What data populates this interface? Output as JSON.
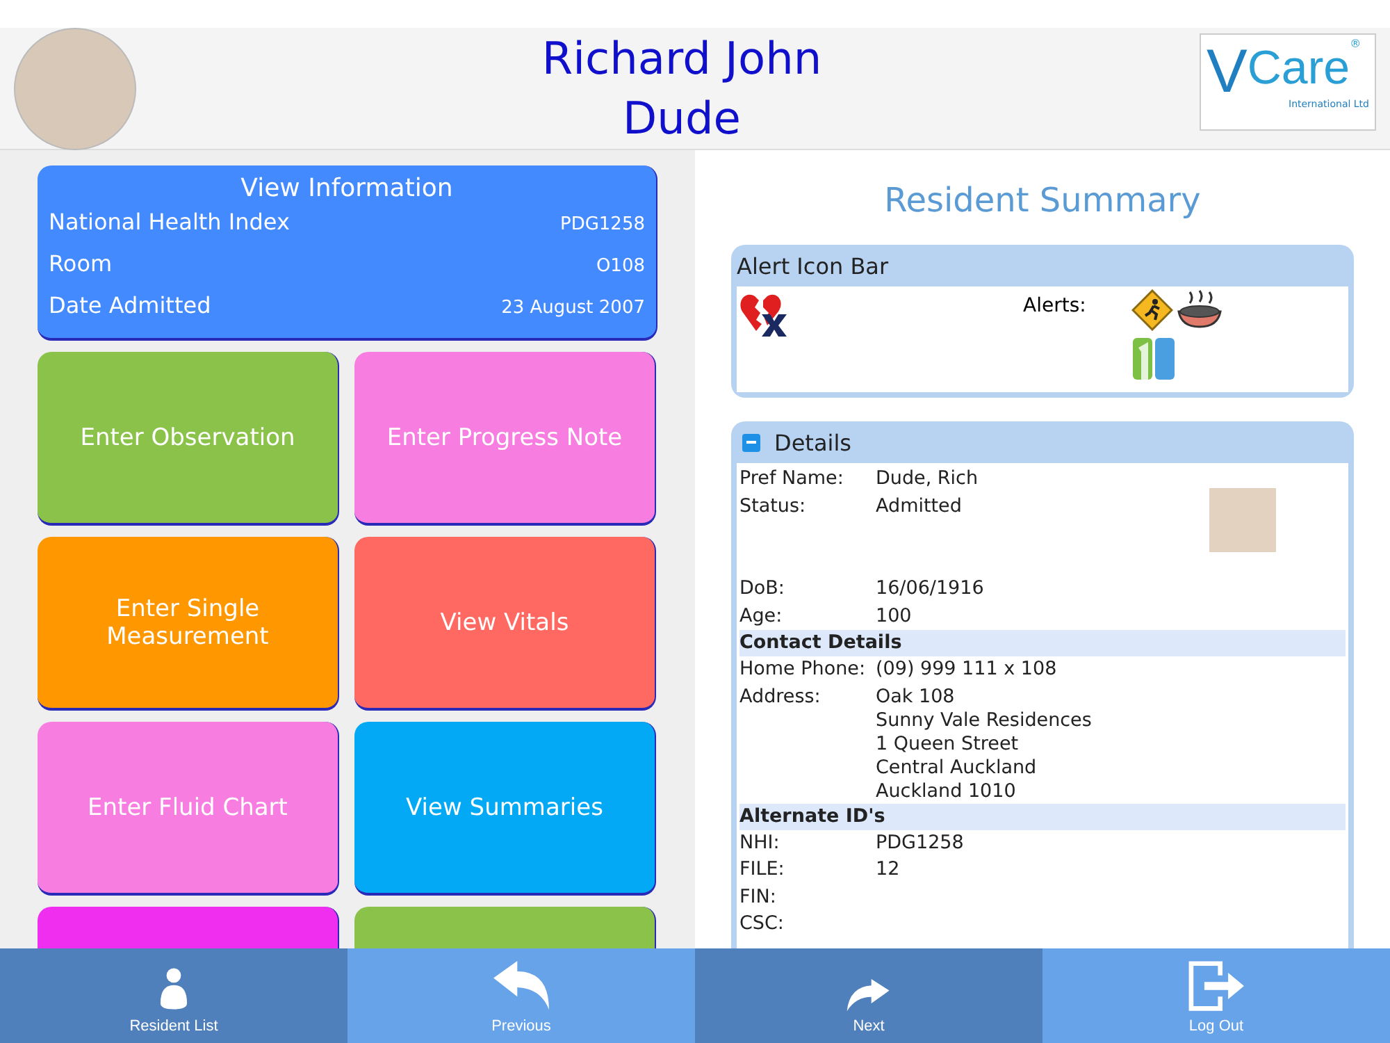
{
  "header": {
    "name_lines": [
      "Richard John",
      "Dude"
    ],
    "logo": {
      "letter": "V",
      "word": "Care",
      "mark": "®",
      "tagline": "International Ltd"
    }
  },
  "info_card": {
    "title": "View Information",
    "rows": [
      {
        "label": "National Health Index",
        "value": "PDG1258"
      },
      {
        "label": "Room",
        "value": "O108"
      },
      {
        "label": "Date Admitted",
        "value": "23 August 2007"
      }
    ]
  },
  "tiles": [
    {
      "label": "Enter Observation",
      "color": "#8bc34a"
    },
    {
      "label": "Enter Progress Note",
      "color": "#f77ee0"
    },
    {
      "label": "Enter Single Measurement",
      "color": "#ff9800"
    },
    {
      "label": "View Vitals",
      "color": "#ff6961"
    },
    {
      "label": "Enter Fluid Chart",
      "color": "#f77ee0"
    },
    {
      "label": "View Summaries",
      "color": "#03a9f4"
    },
    {
      "color": "#f02ef0"
    },
    {
      "color": "#8bc34a"
    }
  ],
  "summary": {
    "title": "Resident Summary",
    "alert_bar": {
      "title": "Alert Icon Bar",
      "alerts_label": "Alerts:"
    },
    "details": {
      "title": "Details",
      "expanded": true,
      "groups": [
        {
          "photo": true,
          "rows": [
            {
              "label": "Pref Name:",
              "lines": [
                "Dude, Rich"
              ]
            },
            {
              "label": "Status:",
              "lines": [
                "Admitted"
              ]
            }
          ]
        },
        {
          "rows": [
            {
              "label": "DoB:",
              "lines": [
                "16/06/1916"
              ]
            },
            {
              "label": "Age:",
              "lines": [
                "100"
              ]
            }
          ]
        },
        {
          "heading": "Contact Details",
          "rows": [
            {
              "label": "Home Phone:",
              "lines": [
                "(09) 999 111 x 108"
              ]
            },
            {
              "label": "Address:",
              "lines": [
                "Oak 108",
                "Sunny Vale Residences",
                "1 Queen Street",
                "Central Auckland",
                "Auckland 1010"
              ]
            }
          ]
        },
        {
          "heading": "Alternate ID's",
          "rows": [
            {
              "label": "NHI:",
              "lines": [
                "PDG1258"
              ]
            },
            {
              "label": "FILE:",
              "lines": [
                "12"
              ]
            },
            {
              "label": "FIN:",
              "lines": []
            },
            {
              "label": "CSC:",
              "lines": []
            }
          ]
        }
      ]
    }
  },
  "footer": [
    {
      "kind": "person",
      "label": "Resident List"
    },
    {
      "kind": "back",
      "label": "Previous"
    },
    {
      "kind": "forward",
      "label": "Next"
    },
    {
      "kind": "logout",
      "label": "Log Out"
    }
  ]
}
